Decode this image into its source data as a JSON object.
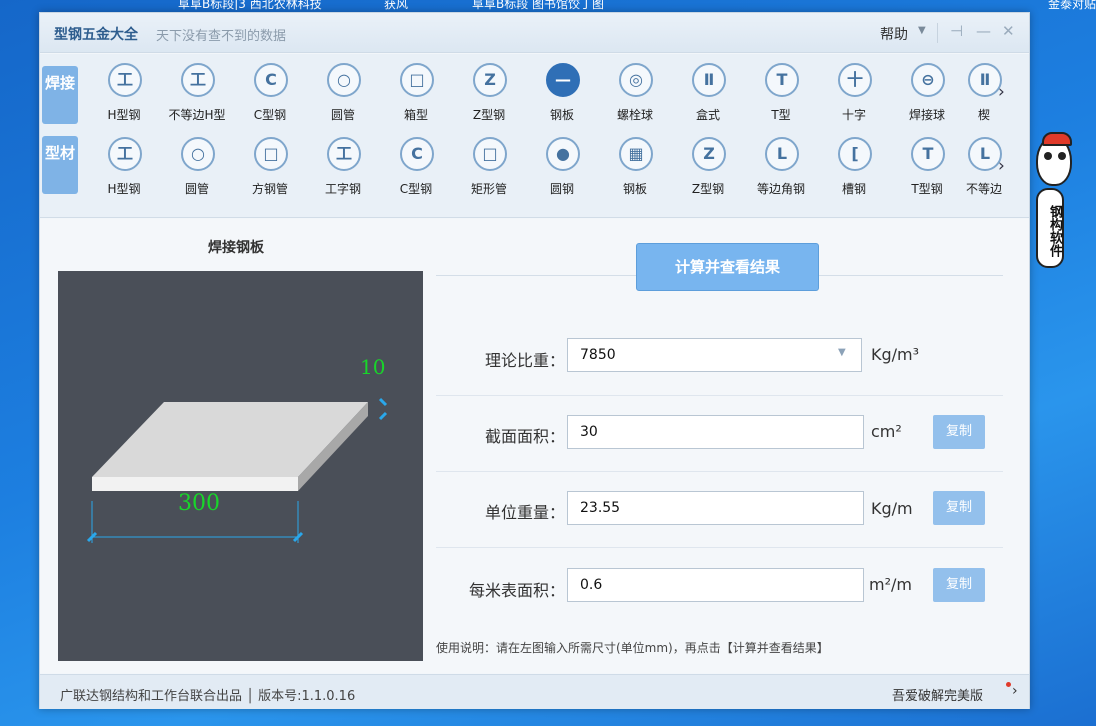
{
  "desktop": {
    "taskbar_items": [
      "阜阜B标段|3 西北农林科技",
      "获风",
      "阜阜B标段 图书馆饺丁图"
    ],
    "right_text": "金泰对贴",
    "mascot_text": "钢构软件"
  },
  "window": {
    "title": "型钢五金大全",
    "subtitle": "天下没有查不到的数据",
    "help_label": "帮助",
    "controls": {
      "pin": "⊣",
      "minimize": "—",
      "close": "✕"
    }
  },
  "categories": [
    {
      "label": "焊接"
    },
    {
      "label": "型材"
    }
  ],
  "welded_tools": [
    {
      "label": "H型钢",
      "glyph": "工"
    },
    {
      "label": "不等边H型",
      "glyph": "工"
    },
    {
      "label": "C型钢",
      "glyph": "C"
    },
    {
      "label": "圆管",
      "glyph": "○"
    },
    {
      "label": "箱型",
      "glyph": "□"
    },
    {
      "label": "Z型钢",
      "glyph": "Z"
    },
    {
      "label": "钢板",
      "glyph": "—"
    },
    {
      "label": "螺栓球",
      "glyph": "◎"
    },
    {
      "label": "盒式",
      "glyph": "Ⅱ"
    },
    {
      "label": "T型",
      "glyph": "T"
    },
    {
      "label": "十字",
      "glyph": "十"
    },
    {
      "label": "焊接球",
      "glyph": "⊖"
    },
    {
      "label": "楔",
      "glyph": "Ⅱ"
    }
  ],
  "profile_tools": [
    {
      "label": "H型钢",
      "glyph": "工"
    },
    {
      "label": "圆管",
      "glyph": "○"
    },
    {
      "label": "方钢管",
      "glyph": "□"
    },
    {
      "label": "工字钢",
      "glyph": "工"
    },
    {
      "label": "C型钢",
      "glyph": "C"
    },
    {
      "label": "矩形管",
      "glyph": "□"
    },
    {
      "label": "圆钢",
      "glyph": "●"
    },
    {
      "label": "钢板",
      "glyph": "▦"
    },
    {
      "label": "Z型钢",
      "glyph": "Z"
    },
    {
      "label": "等边角钢",
      "glyph": "L"
    },
    {
      "label": "槽钢",
      "glyph": "["
    },
    {
      "label": "T型钢",
      "glyph": "T"
    },
    {
      "label": "不等边",
      "glyph": "L"
    }
  ],
  "content": {
    "drawing_title": "焊接钢板",
    "dim_thickness": "10",
    "dim_width": "300",
    "calc_button": "计算并查看结果",
    "fields": {
      "density": {
        "label": "理论比重：",
        "value": "7850",
        "unit": "Kg/m³"
      },
      "area": {
        "label": "截面面积：",
        "value": "30",
        "unit": "cm²",
        "copy": "复制"
      },
      "weight": {
        "label": "单位重量：",
        "value": "23.55",
        "unit": "Kg/m",
        "copy": "复制"
      },
      "surface": {
        "label": "每米表面积：",
        "value": "0.6",
        "unit": "m²/m",
        "copy": "复制"
      }
    },
    "usage": "使用说明：请在左图输入所需尺寸(单位mm)，再点击【计算并查看结果】"
  },
  "status": {
    "left": "广联达钢结构和工作台联合出品 │ 版本号:1.1.0.16",
    "right": "吾爱破解完美版"
  }
}
